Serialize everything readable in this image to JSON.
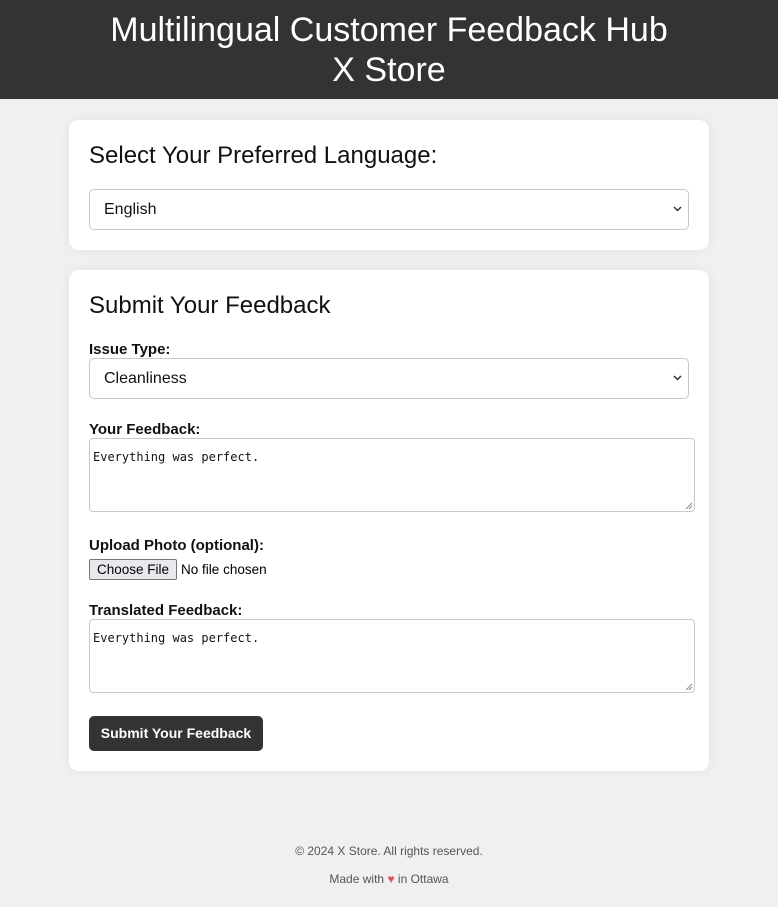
{
  "header": {
    "title_line1": "Multilingual Customer Feedback Hub",
    "title_line2": "X Store"
  },
  "language_section": {
    "heading": "Select Your Preferred Language:",
    "selected_language": "English"
  },
  "feedback_form": {
    "heading": "Submit Your Feedback",
    "issue_type_label": "Issue Type:",
    "issue_type_value": "Cleanliness",
    "feedback_label": "Your Feedback:",
    "feedback_value": "Everything was perfect.",
    "upload_label": "Upload Photo (optional):",
    "choose_file_label": "Choose File",
    "file_status": "No file chosen",
    "translated_label": "Translated Feedback:",
    "translated_value": "Everything was perfect.",
    "submit_label": "Submit Your Feedback"
  },
  "footer": {
    "copyright": "© 2024 X Store. All rights reserved.",
    "made_prefix": "Made with",
    "heart": "♥",
    "made_suffix": "in Ottawa"
  },
  "colors": {
    "header_bg": "#333333",
    "page_bg": "#f0f0f0",
    "button_bg": "#333333",
    "heart": "#e05555"
  },
  "icons": {
    "select_arrow": "chevron-down-icon",
    "resize_handle": "resize-grip-icon",
    "heart": "heart-icon"
  }
}
